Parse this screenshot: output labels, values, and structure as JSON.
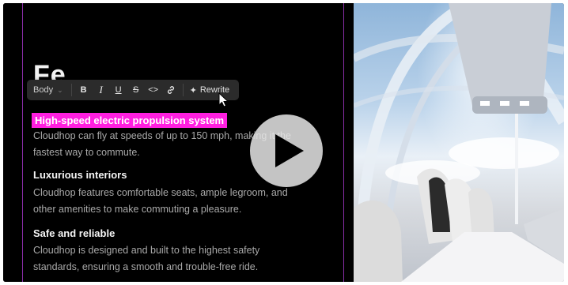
{
  "toolbar": {
    "style_label": "Body",
    "bold_label": "B",
    "italic_label": "I",
    "underline_label": "U",
    "strike_label": "S",
    "code_label": "<>",
    "link_icon": "link-icon",
    "rewrite_label": "Rewrite"
  },
  "document": {
    "heading": "Fe",
    "sections": [
      {
        "title": "High-speed electric propulsion system",
        "line1": "Cloudhop can fly at speeds of up to 150 mph, making it the",
        "line2": "fastest way to commute."
      },
      {
        "title": "Luxurious interiors",
        "line1": "Cloudhop features comfortable seats, ample legroom, and",
        "line2": "other amenities to make commuting a pleasure."
      },
      {
        "title": "Safe and reliable",
        "line1": "Cloudhop is designed and built to the highest safety",
        "line2": "standards, ensuring a smooth and trouble-free ride."
      }
    ]
  },
  "colors": {
    "highlight": "#ff1fe0",
    "guide": "#8a2ea8",
    "background": "#000000"
  },
  "icons": [
    "chevron-down-icon",
    "link-icon",
    "sparkle-icon",
    "mouse-cursor-icon",
    "play-icon"
  ]
}
